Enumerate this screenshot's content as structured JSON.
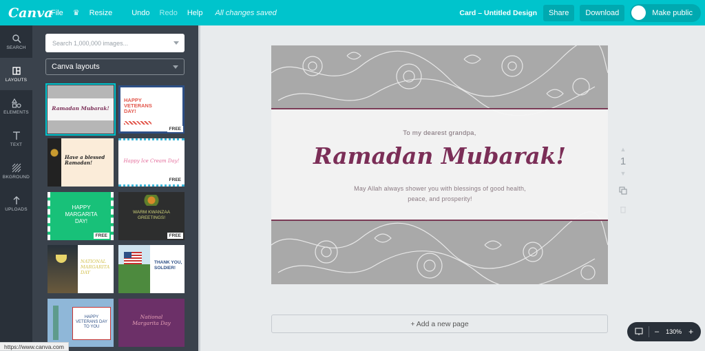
{
  "app": {
    "logo": "Canva"
  },
  "menu": {
    "file": "File",
    "resize": "Resize",
    "undo": "Undo",
    "redo": "Redo",
    "help": "Help",
    "saved_status": "All changes saved"
  },
  "header": {
    "doc_title": "Card – Untitled Design",
    "share": "Share",
    "download": "Download",
    "make_public": "Make public"
  },
  "rail": {
    "items": [
      {
        "label": "SEARCH",
        "icon": "search-icon"
      },
      {
        "label": "LAYOUTS",
        "icon": "layouts-icon"
      },
      {
        "label": "ELEMENTS",
        "icon": "elements-icon"
      },
      {
        "label": "TEXT",
        "icon": "text-icon"
      },
      {
        "label": "BKGROUND",
        "icon": "background-icon"
      },
      {
        "label": "UPLOADS",
        "icon": "upload-icon"
      }
    ]
  },
  "panel": {
    "search_placeholder": "Search 1,000,000 images...",
    "layout_select": "Canva layouts",
    "templates": [
      {
        "text": "Ramadan Mubarak!",
        "free": ""
      },
      {
        "text": "HAPPY VETERANS DAY!",
        "free": "FREE"
      },
      {
        "text": "Have a blessed Ramadan!",
        "free": ""
      },
      {
        "text": "Happy Ice Cream Day!",
        "free": "FREE"
      },
      {
        "text": "HAPPY MARGARITA DAY!",
        "free": "FREE"
      },
      {
        "text": "WARM KWANZAA GREETINGS!",
        "free": "FREE"
      },
      {
        "text": "NATIONAL MARGARITA DAY",
        "free": ""
      },
      {
        "text": "THANK YOU, SOLDIER!",
        "free": ""
      },
      {
        "text": "HAPPY VETERANS DAY TO YOU",
        "free": ""
      },
      {
        "text": "National Margarita Day",
        "free": ""
      }
    ]
  },
  "card": {
    "greeting": "To my dearest grandpa,",
    "headline": "Ramadan Mubarak!",
    "message": "May Allah always shower you with blessings of good health, peace, and prosperity!"
  },
  "page_controls": {
    "page_number": "1"
  },
  "add_page": "+ Add a new page",
  "zoom": {
    "minus": "–",
    "level": "130%",
    "plus": "+"
  },
  "status_url": "https://www.canva.com",
  "colors": {
    "brand": "#00c4cc",
    "headline": "#7b2e57",
    "rail": "#293039",
    "panel": "#3a424c"
  }
}
